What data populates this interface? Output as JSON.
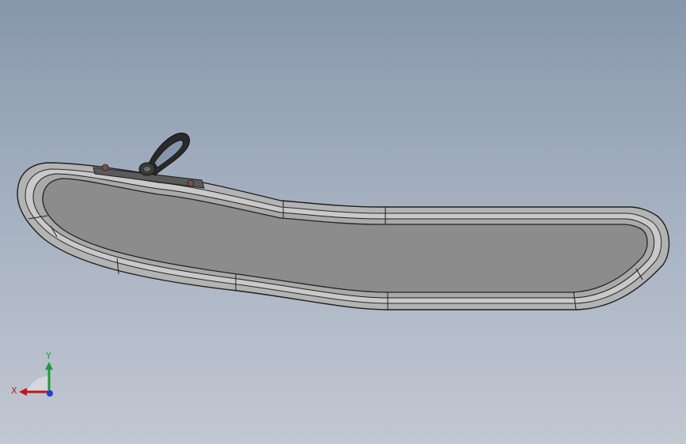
{
  "triad": {
    "x_label": "X",
    "y_label": "Y",
    "x_color": "#c0161c",
    "y_color": "#1e9a3a",
    "z_color": "#1f3fd0"
  },
  "model": {
    "face_color": "#8c8c8c",
    "rim_color": "#b9b9b9",
    "edge_color": "#1e1e1e",
    "handle_color": "#2a2a2a"
  }
}
